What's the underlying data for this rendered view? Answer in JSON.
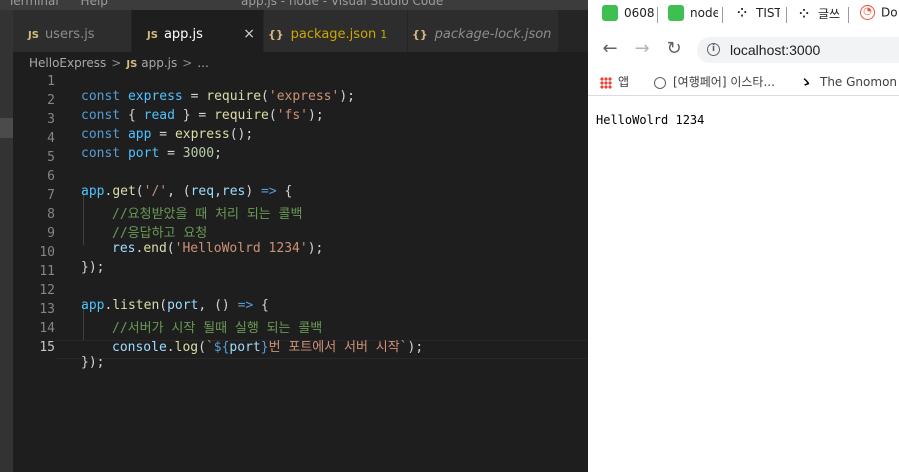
{
  "vscode": {
    "menu": [
      "Terminal",
      "Help"
    ],
    "window_title": "app.js - node - Visual Studio Code",
    "tabs": [
      {
        "icon": "JS",
        "label": "users.js"
      },
      {
        "icon": "JS",
        "label": "app.js",
        "close": "×"
      },
      {
        "icon": "{}",
        "label": "package.json",
        "badge": "1"
      },
      {
        "icon": "{}",
        "label": "package-lock.json"
      }
    ],
    "breadcrumb": {
      "folder": "HelloExpress",
      "sep": ">",
      "file_icon": "JS",
      "file": "app.js",
      "rest": "..."
    },
    "line_numbers": [
      "1",
      "2",
      "3",
      "4",
      "5",
      "6",
      "7",
      "8",
      "9",
      "10",
      "11",
      "12",
      "13",
      "14",
      "15"
    ],
    "code": {
      "l1": [
        "const",
        " ",
        "express",
        " = ",
        "require",
        "(",
        "'express'",
        ");"
      ],
      "l2": [
        "const",
        " { ",
        "read",
        " } = ",
        "require",
        "(",
        "'fs'",
        ");"
      ],
      "l3": [
        "const",
        " ",
        "app",
        " = ",
        "express",
        "();"
      ],
      "l4": [
        "const",
        " ",
        "port",
        " = ",
        "3000",
        ";"
      ],
      "l6": [
        "app",
        ".",
        "get",
        "(",
        "'/'",
        ", (",
        "req",
        ",",
        "res",
        ") ",
        "=>",
        " {"
      ],
      "l7": [
        "//요청받았을 때 처리 되는 콜백"
      ],
      "l8": [
        "//응답하고 요청"
      ],
      "l9": [
        "res",
        ".",
        "end",
        "(",
        "'HelloWolrd 1234'",
        ");"
      ],
      "l10": [
        "});"
      ],
      "l12": [
        "app",
        ".",
        "listen",
        "(",
        "port",
        ", () ",
        "=>",
        " {"
      ],
      "l13": [
        "//서버가 시작 될때 실행 되는 콜백"
      ],
      "l14": [
        "console",
        ".",
        "log",
        "(",
        "`",
        "${",
        "port",
        "}",
        "번 포트에서 서버 시작`",
        ");"
      ],
      "l15": [
        "});"
      ]
    }
  },
  "chrome": {
    "tabs": [
      {
        "label": "0608",
        "color": "#3dbf52"
      },
      {
        "label": "node",
        "color": "#3dbf52"
      },
      {
        "label": "TISTO",
        "color": "#222222"
      },
      {
        "label": "글쓰",
        "color": "#222222"
      },
      {
        "label": "Do",
        "color": "#e8533b"
      }
    ],
    "url": "localhost:3000",
    "bookmarks": [
      "앱",
      "[여행페어] 이스타...",
      "The Gnomon"
    ],
    "page_text": "HelloWolrd 1234"
  },
  "colors": {
    "editor_bg": "#1e1e1e",
    "keyword": "#569cd6",
    "string": "#ce9178",
    "comment": "#6a9955"
  }
}
